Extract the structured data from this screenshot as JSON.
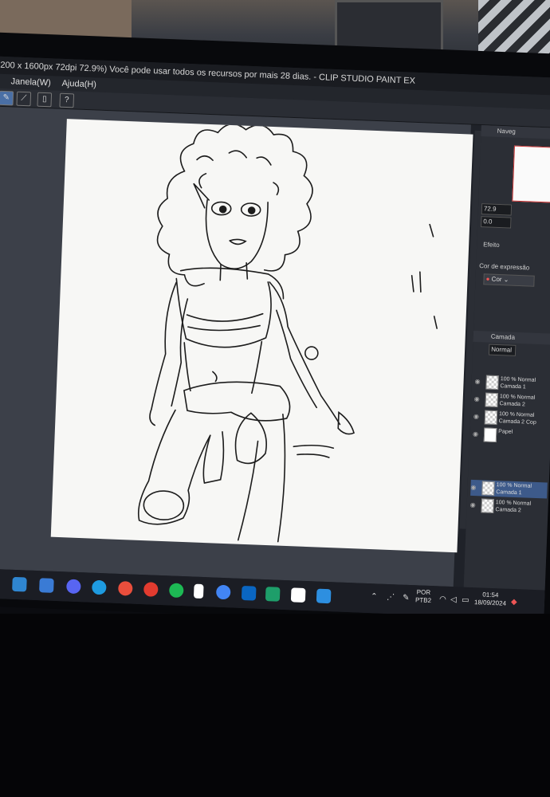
{
  "window": {
    "title": "200 x 1600px 72dpi 72.9%) Você pode usar todos os recursos por mais 28 dias. - CLIP STUDIO PAINT EX"
  },
  "menu": {
    "janela": "Janela(W)",
    "ajuda": "Ajuda(H)"
  },
  "toolbar": {
    "help_glyph": "?"
  },
  "navigator": {
    "title": "Naveg",
    "zoom": "72.9",
    "rotation": "0.0"
  },
  "effects": {
    "label": "Efeito",
    "expression_label": "Cor de expressão",
    "expression_value": "Cor"
  },
  "layers": {
    "title": "Camada",
    "blend_mode": "Normal",
    "items": [
      {
        "line1": "100 % Normal",
        "line2": "Camada 1",
        "selected": false
      },
      {
        "line1": "100 % Normal",
        "line2": "Camada 2",
        "selected": false
      },
      {
        "line1": "100 % Normal",
        "line2": "Camada 2 Cop",
        "selected": false
      },
      {
        "line1": "",
        "line2": "Papel",
        "selected": false
      }
    ],
    "lower": [
      {
        "line1": "100 % Normal",
        "line2": "Camada 1",
        "selected": true
      },
      {
        "line1": "100 % Normal",
        "line2": "Camada 2",
        "selected": false
      }
    ]
  },
  "taskbar": {
    "lang_line1": "POR",
    "lang_line2": "PTB2",
    "time": "01:54",
    "date": "18/09/2024",
    "app_colors": [
      "#f2b233",
      "#2f86d1",
      "#3a7bd5",
      "#5865f2",
      "#1e9be0",
      "#e94e3c",
      "#e23b2f",
      "#1db954",
      "#ffffff",
      "#4285f4",
      "#0a66c2",
      "#1e9e6a",
      "#ffffff",
      "#2d8fe0"
    ]
  }
}
